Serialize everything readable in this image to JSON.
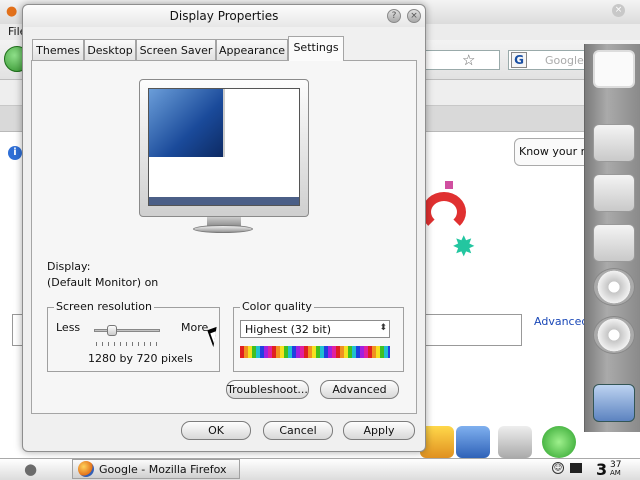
{
  "dialog": {
    "title": "Display Properties",
    "tabs": [
      "Themes",
      "Desktop",
      "Screen Saver",
      "Appearance",
      "Settings"
    ],
    "active_tab": "Settings",
    "display_label": "Display:",
    "display_value": "(Default Monitor) on",
    "screen_resolution": {
      "title": "Screen resolution",
      "less_label": "Less",
      "more_label": "More",
      "value_text": "1280 by 720 pixels",
      "slider_fraction": 0.25
    },
    "color_quality": {
      "title": "Color quality",
      "selected": "Highest (32 bit)"
    },
    "buttons": {
      "troubleshoot": "Troubleshoot...",
      "advanced": "Advanced",
      "ok": "OK",
      "cancel": "Cancel",
      "apply": "Apply"
    }
  },
  "firefox": {
    "menu_first": "File",
    "search_placeholder": "Google",
    "tooltip_text": "Know your right",
    "advanced_link": "Advanced search"
  },
  "taskbar": {
    "task_label": "Google - Mozilla Firefox",
    "clock_hour": "3",
    "clock_minutes": "37",
    "clock_ampm": "AM"
  }
}
